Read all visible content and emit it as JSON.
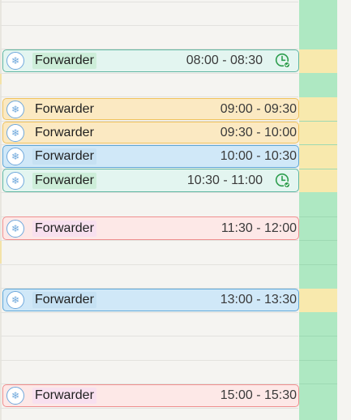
{
  "calendar": {
    "events": [
      {
        "title": "Forwarder",
        "time": "08:00 - 08:30",
        "color": "#e3f5f0",
        "status_icon": "clock-check-icon"
      },
      {
        "title": "Forwarder",
        "time": "09:00 - 09:30",
        "color": "#fbe9c2",
        "status_icon": ""
      },
      {
        "title": "Forwarder",
        "time": "09:30 - 10:00",
        "color": "#fbe9c2",
        "status_icon": ""
      },
      {
        "title": "Forwarder",
        "time": "10:00 - 10:30",
        "color": "#d0e8f8",
        "status_icon": ""
      },
      {
        "title": "Forwarder",
        "time": "10:30 - 11:00",
        "color": "#e3f5f0",
        "status_icon": "clock-check-icon"
      },
      {
        "title": "Forwarder",
        "time": "11:30 - 12:00",
        "color": "#fde8e7",
        "status_icon": ""
      },
      {
        "title": "Forwarder",
        "time": "13:00 - 13:30",
        "color": "#d0e8f8",
        "status_icon": ""
      },
      {
        "title": "Forwarder",
        "time": "15:00 - 15:30",
        "color": "#fde8e7",
        "status_icon": ""
      }
    ],
    "event_icon": "snowflake-icon",
    "colors": {
      "available_column": "#aee8c2",
      "booked_column": "#f8e9ad",
      "status_green": "#2e9e4f"
    }
  }
}
